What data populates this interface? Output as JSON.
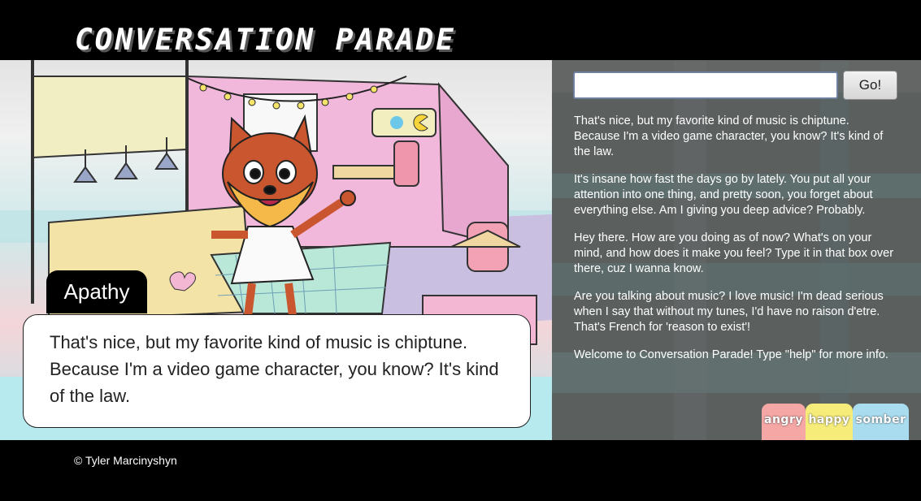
{
  "header": {
    "title": "CONVERSATION PARADE"
  },
  "scene": {
    "character_name": "Apathy",
    "speech": "That's nice, but my favorite kind of music is chiptune. Because I'm a video game character, you know? It's kind of the law."
  },
  "chat": {
    "input_value": "",
    "go_label": "Go!",
    "log": [
      "That's nice, but my favorite kind of music is chiptune. Because I'm a video game character, you know? It's kind of the law.",
      "It's insane how fast the days go by lately. You put all your attention into one thing, and pretty soon, you forget about everything else. Am I giving you deep advice? Probably.",
      "Hey there. How are you doing as of now? What's on your mind, and how does it make you feel? Type it in that box over there, cuz I wanna know.",
      "Are you talking about music? I love music! I'm dead serious when I say that without my tunes, I'd have no raison d'etre. That's French for 'reason to exist'!",
      "Welcome to Conversation Parade! Type \"help\" for more info."
    ]
  },
  "moods": [
    {
      "label": "angry",
      "color": "#f4a7a5"
    },
    {
      "label": "happy",
      "color": "#f6ec7a"
    },
    {
      "label": "somber",
      "color": "#a9dcef"
    }
  ],
  "footer": {
    "copyright": "© Tyler Marcinyshyn"
  }
}
